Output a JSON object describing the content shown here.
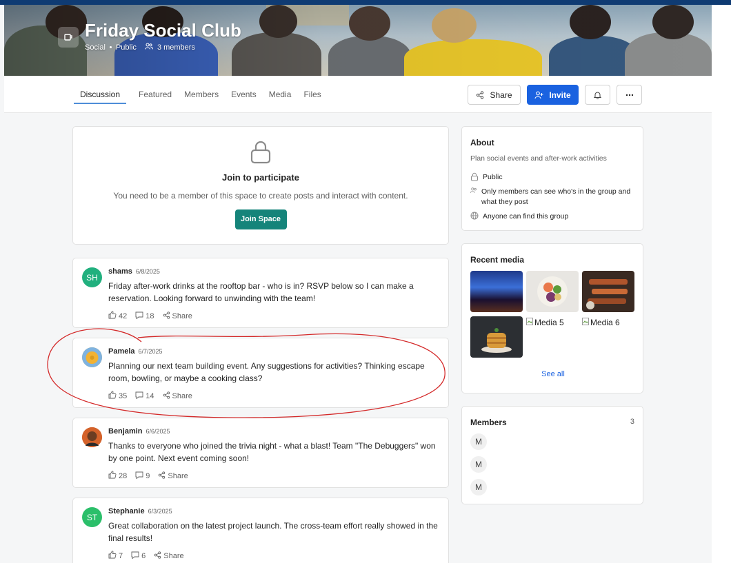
{
  "header": {
    "title": "Friday Social Club",
    "category": "Social",
    "visibility": "Public",
    "members_label": "3 members"
  },
  "tabs": [
    "Discussion",
    "Featured",
    "Members",
    "Events",
    "Media",
    "Files"
  ],
  "active_tab": "Discussion",
  "actions": {
    "share": "Share",
    "invite": "Invite"
  },
  "join": {
    "title": "Join to participate",
    "message": "You need to be a member of this space to create posts and interact with content.",
    "button": "Join Space"
  },
  "posts": [
    {
      "author": "shams",
      "date": "6/8/2025",
      "initials": "SH",
      "avatar_color": "#21b07e",
      "text": "Friday after-work drinks at the rooftop bar - who is in? RSVP below so I can make a reservation. Looking forward to unwinding with the team!",
      "likes": "42",
      "comments": "18",
      "share": "Share"
    },
    {
      "author": "Pamela",
      "date": "6/7/2025",
      "initials": "",
      "avatar_color": "#f2b233",
      "text": "Planning our next team building event. Any suggestions for activities? Thinking escape room, bowling, or maybe a cooking class?",
      "likes": "35",
      "comments": "14",
      "share": "Share"
    },
    {
      "author": "Benjamin",
      "date": "6/6/2025",
      "initials": "",
      "avatar_color": "#c8571d",
      "text": "Thanks to everyone who joined the trivia night - what a blast! Team \"The Debuggers\" won by one point. Next event coming soon!",
      "likes": "28",
      "comments": "9",
      "share": "Share"
    },
    {
      "author": "Stephanie",
      "date": "6/3/2025",
      "initials": "ST",
      "avatar_color": "#2bbf6a",
      "text": "Great collaboration on the latest project launch. The cross-team effort really showed in the final results!",
      "likes": "7",
      "comments": "6",
      "share": "Share"
    }
  ],
  "about": {
    "title": "About",
    "description": "Plan social events and after-work activities",
    "public": "Public",
    "privacy": "Only members can see who's in the group and what they post",
    "findable": "Anyone can find this group"
  },
  "recent_media": {
    "title": "Recent media",
    "broken_labels": [
      "Media 5",
      "Media 6"
    ],
    "see_all": "See all"
  },
  "members_panel": {
    "title": "Members",
    "count": "3",
    "initials": [
      "M",
      "M",
      "M"
    ]
  }
}
